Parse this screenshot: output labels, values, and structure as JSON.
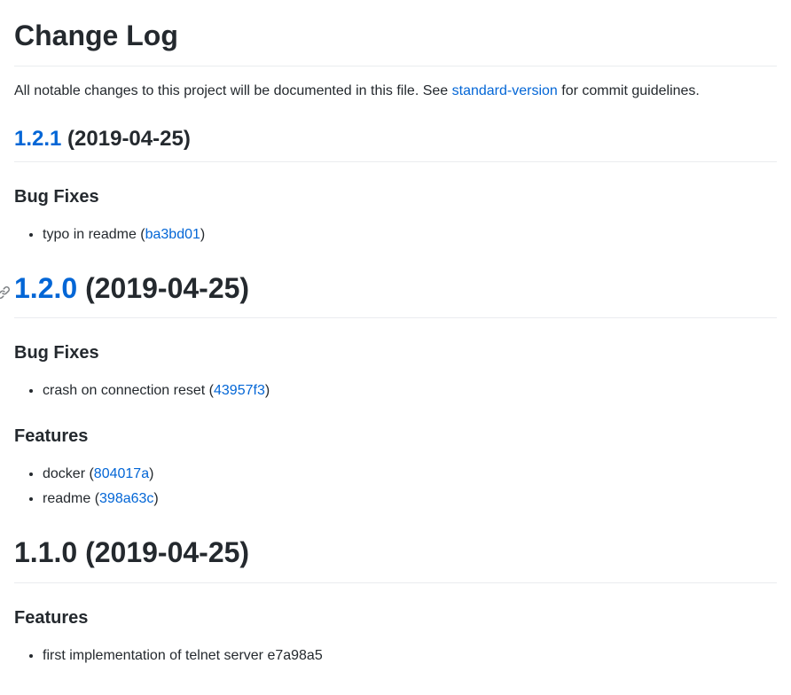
{
  "heading": "Change Log",
  "intro": {
    "prefix": "All notable changes to this project will be documented in this file. See ",
    "link": "standard-version",
    "suffix": " for commit guidelines."
  },
  "v121": {
    "link": "1.2.1",
    "date": " (2019-04-25)",
    "bugfixes_heading": "Bug Fixes",
    "bugfixes": {
      "item1": {
        "prefix": "typo in readme (",
        "hash": "ba3bd01",
        "suffix": ")"
      }
    }
  },
  "v120": {
    "link": "1.2.0",
    "date": " (2019-04-25)",
    "bugfixes_heading": "Bug Fixes",
    "bugfixes": {
      "item1": {
        "prefix": "crash on connection reset (",
        "hash": "43957f3",
        "suffix": ")"
      }
    },
    "features_heading": "Features",
    "features": {
      "item1": {
        "prefix": "docker (",
        "hash": "804017a",
        "suffix": ")"
      },
      "item2": {
        "prefix": "readme (",
        "hash": "398a63c",
        "suffix": ")"
      }
    }
  },
  "v110": {
    "title": "1.1.0 (2019-04-25)",
    "features_heading": "Features",
    "features": {
      "item1": "first implementation of telnet server e7a98a5"
    }
  }
}
